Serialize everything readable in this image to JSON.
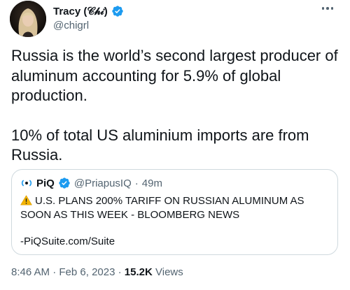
{
  "author": {
    "display_name": "Tracy (𝒞𝒽𝒾)",
    "handle": "@chigrl",
    "verified_icon": "verified-badge-icon",
    "accent_color": "#1d9bf0"
  },
  "tweet": {
    "paragraphs": [
      "Russia is the world’s second largest producer of aluminum accounting for 5.9% of global production.",
      "10% of total US aluminium imports are from Russia."
    ]
  },
  "quote": {
    "name": "PiQ",
    "handle": "@PriapusIQ",
    "separator": "·",
    "time": "49m",
    "warning_icon": "warning-icon",
    "headline": "U.S. PLANS 200% TARIFF ON RUSSIAN ALUMINUM AS SOON AS THIS WEEK - BLOOMBERG NEWS",
    "link": "-PiQSuite.com/Suite"
  },
  "meta": {
    "time": "8:46 AM",
    "separator_1": "·",
    "date": "Feb 6, 2023",
    "separator_2": "·",
    "views_count": "15.2K",
    "views_label": "Views"
  }
}
